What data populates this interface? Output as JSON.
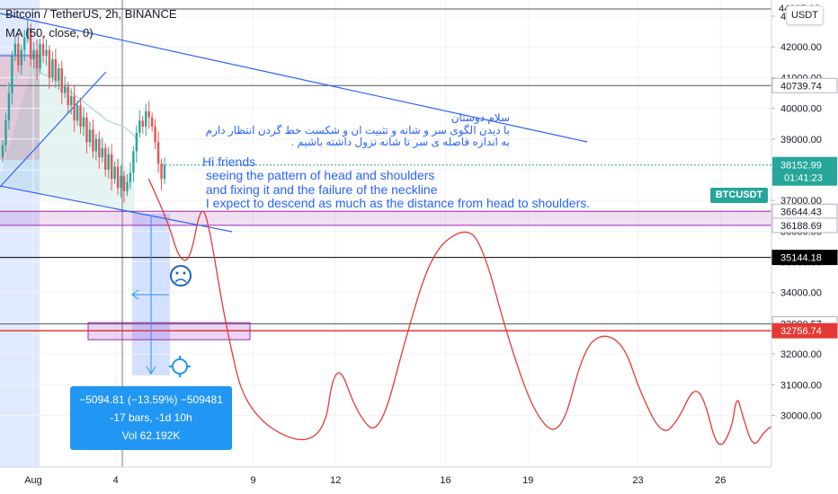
{
  "header": {
    "title": "Bitcoin / TetherUS, 2h, BINANCE",
    "ma_label": "MA (50, close, 0)",
    "currency_button": "USDT"
  },
  "chart_data": {
    "type": "candlestick",
    "symbol": "BTCUSDT",
    "interval": "2h",
    "exchange": "BINANCE",
    "ylim": [
      29500,
      44100
    ],
    "y_ticks": [
      30000,
      31000,
      32000,
      33000,
      34000,
      35000,
      36000,
      37000,
      38000,
      39000,
      40000,
      41000,
      42000,
      43000
    ],
    "y_tick_labels": [
      "30000.00",
      "31000.00",
      "32000.00",
      "33000.00",
      "34000.00",
      "35000.00",
      "36000.00",
      "37000.00",
      "38000.00",
      "39000.00",
      "40000.00",
      "41000.00",
      "42000.00",
      "43000.00"
    ],
    "x_ticks": [
      {
        "label": "Aug",
        "day": 1
      },
      {
        "label": "4",
        "day": 4
      },
      {
        "label": "9",
        "day": 9
      },
      {
        "label": "12",
        "day": 12
      },
      {
        "label": "16",
        "day": 16
      },
      {
        "label": "19",
        "day": 19
      },
      {
        "label": "23",
        "day": 23
      },
      {
        "label": "26",
        "day": 26
      }
    ],
    "candle_closes": [
      38800,
      39600,
      40500,
      41700,
      42100,
      41400,
      41900,
      42300,
      42600,
      41600,
      41900,
      41300,
      42100,
      41700,
      41900,
      41000,
      41600,
      40900,
      41300,
      40500,
      40700,
      40100,
      40400,
      39600,
      40100,
      39400,
      39700,
      38900,
      39300,
      38600,
      39000,
      38400,
      38700,
      38000,
      38500,
      37700,
      38100,
      37400,
      37800,
      37300,
      37600,
      37900,
      38600,
      39200,
      39600,
      39400,
      39900,
      39700,
      39400,
      38900,
      38200,
      37700,
      38150
    ],
    "ma_values": [
      40600,
      40900,
      41100,
      41200,
      41200,
      41100,
      41000,
      40800,
      40600,
      40400,
      40200,
      40000,
      39800,
      39600,
      39500,
      39400,
      39200,
      38900
    ],
    "price_levels": [
      {
        "price": "40739.74",
        "color": "#555555",
        "style": "line"
      },
      {
        "price": "36644.43",
        "color": "#9c27b0",
        "style": "zone-top"
      },
      {
        "price": "36188.69",
        "color": "#9c27b0",
        "style": "zone-bottom"
      },
      {
        "price": "35144.18",
        "color": "#000000",
        "style": "line"
      },
      {
        "price": "32980.57",
        "color": "#555555",
        "style": "line"
      },
      {
        "price": "32756.74",
        "color": "#e53935",
        "style": "target"
      }
    ],
    "top_cut_label": "44007.08",
    "current_price": "38152.99",
    "countdown": "01:41:23",
    "forecast_path": [
      [
        5.2,
        37700
      ],
      [
        5.9,
        36300
      ],
      [
        6.3,
        35100
      ],
      [
        6.7,
        35000
      ],
      [
        7.1,
        36900
      ],
      [
        7.4,
        36200
      ],
      [
        8.0,
        32900
      ],
      [
        8.8,
        29900
      ],
      [
        11.5,
        28800
      ],
      [
        12.0,
        32000
      ],
      [
        12.8,
        30000
      ],
      [
        13.6,
        29300
      ],
      [
        14.6,
        32700
      ],
      [
        15.5,
        35300
      ],
      [
        16.6,
        36100
      ],
      [
        17.3,
        35700
      ],
      [
        18.3,
        32400
      ],
      [
        19.3,
        29900
      ],
      [
        20.2,
        29300
      ],
      [
        21.0,
        32100
      ],
      [
        21.7,
        32700
      ],
      [
        22.5,
        32300
      ],
      [
        23.1,
        30700
      ],
      [
        23.9,
        29300
      ],
      [
        24.5,
        29900
      ],
      [
        25.0,
        30900
      ],
      [
        25.4,
        30600
      ],
      [
        25.9,
        28800
      ],
      [
        26.4,
        29500
      ],
      [
        26.6,
        30700
      ],
      [
        26.8,
        30000
      ],
      [
        27.2,
        28900
      ],
      [
        27.6,
        29500
      ],
      [
        28.0,
        29700
      ]
    ],
    "annotations": {
      "persian_lines": [
        "سلام دوستان",
        "با دیدن الگوی سر و شانه و تثبیت ان و شکست خط گردن انتظار دارم",
        "به اندازه فاصله ی سر تا شانه نزول داشته باشیم ."
      ],
      "english_lines": [
        "Hi friends",
        " seeing the pattern of head and shoulders",
        " and fixing it and the failure of the neckline",
        " I expect to descend as much as the distance from head to shoulders."
      ]
    },
    "measurement": {
      "line1": "−5094.81 (−13.59%) −509481",
      "line2": "-17 bars, -1d 10h",
      "line3": "Vol 62.192K"
    },
    "colors": {
      "up": "#26a69a",
      "down": "#ef5350",
      "trendline": "#2962ff",
      "forecast": "#e53935",
      "zone": "#9c27b0",
      "measure": "#2196f3",
      "ma": "#b2dfdb"
    }
  }
}
